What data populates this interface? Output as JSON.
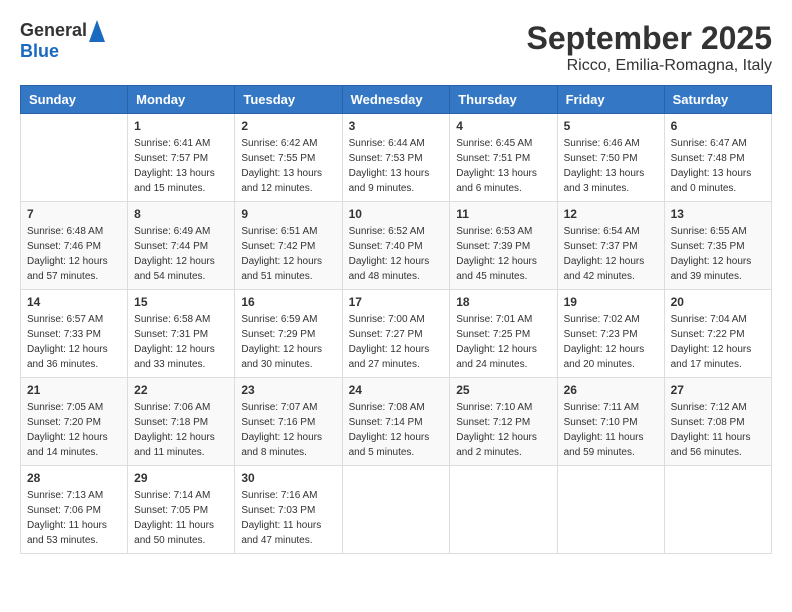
{
  "logo": {
    "general": "General",
    "blue": "Blue"
  },
  "title": {
    "month": "September 2025",
    "location": "Ricco, Emilia-Romagna, Italy"
  },
  "headers": [
    "Sunday",
    "Monday",
    "Tuesday",
    "Wednesday",
    "Thursday",
    "Friday",
    "Saturday"
  ],
  "weeks": [
    [
      {
        "day": "",
        "info": ""
      },
      {
        "day": "1",
        "info": "Sunrise: 6:41 AM\nSunset: 7:57 PM\nDaylight: 13 hours\nand 15 minutes."
      },
      {
        "day": "2",
        "info": "Sunrise: 6:42 AM\nSunset: 7:55 PM\nDaylight: 13 hours\nand 12 minutes."
      },
      {
        "day": "3",
        "info": "Sunrise: 6:44 AM\nSunset: 7:53 PM\nDaylight: 13 hours\nand 9 minutes."
      },
      {
        "day": "4",
        "info": "Sunrise: 6:45 AM\nSunset: 7:51 PM\nDaylight: 13 hours\nand 6 minutes."
      },
      {
        "day": "5",
        "info": "Sunrise: 6:46 AM\nSunset: 7:50 PM\nDaylight: 13 hours\nand 3 minutes."
      },
      {
        "day": "6",
        "info": "Sunrise: 6:47 AM\nSunset: 7:48 PM\nDaylight: 13 hours\nand 0 minutes."
      }
    ],
    [
      {
        "day": "7",
        "info": "Sunrise: 6:48 AM\nSunset: 7:46 PM\nDaylight: 12 hours\nand 57 minutes."
      },
      {
        "day": "8",
        "info": "Sunrise: 6:49 AM\nSunset: 7:44 PM\nDaylight: 12 hours\nand 54 minutes."
      },
      {
        "day": "9",
        "info": "Sunrise: 6:51 AM\nSunset: 7:42 PM\nDaylight: 12 hours\nand 51 minutes."
      },
      {
        "day": "10",
        "info": "Sunrise: 6:52 AM\nSunset: 7:40 PM\nDaylight: 12 hours\nand 48 minutes."
      },
      {
        "day": "11",
        "info": "Sunrise: 6:53 AM\nSunset: 7:39 PM\nDaylight: 12 hours\nand 45 minutes."
      },
      {
        "day": "12",
        "info": "Sunrise: 6:54 AM\nSunset: 7:37 PM\nDaylight: 12 hours\nand 42 minutes."
      },
      {
        "day": "13",
        "info": "Sunrise: 6:55 AM\nSunset: 7:35 PM\nDaylight: 12 hours\nand 39 minutes."
      }
    ],
    [
      {
        "day": "14",
        "info": "Sunrise: 6:57 AM\nSunset: 7:33 PM\nDaylight: 12 hours\nand 36 minutes."
      },
      {
        "day": "15",
        "info": "Sunrise: 6:58 AM\nSunset: 7:31 PM\nDaylight: 12 hours\nand 33 minutes."
      },
      {
        "day": "16",
        "info": "Sunrise: 6:59 AM\nSunset: 7:29 PM\nDaylight: 12 hours\nand 30 minutes."
      },
      {
        "day": "17",
        "info": "Sunrise: 7:00 AM\nSunset: 7:27 PM\nDaylight: 12 hours\nand 27 minutes."
      },
      {
        "day": "18",
        "info": "Sunrise: 7:01 AM\nSunset: 7:25 PM\nDaylight: 12 hours\nand 24 minutes."
      },
      {
        "day": "19",
        "info": "Sunrise: 7:02 AM\nSunset: 7:23 PM\nDaylight: 12 hours\nand 20 minutes."
      },
      {
        "day": "20",
        "info": "Sunrise: 7:04 AM\nSunset: 7:22 PM\nDaylight: 12 hours\nand 17 minutes."
      }
    ],
    [
      {
        "day": "21",
        "info": "Sunrise: 7:05 AM\nSunset: 7:20 PM\nDaylight: 12 hours\nand 14 minutes."
      },
      {
        "day": "22",
        "info": "Sunrise: 7:06 AM\nSunset: 7:18 PM\nDaylight: 12 hours\nand 11 minutes."
      },
      {
        "day": "23",
        "info": "Sunrise: 7:07 AM\nSunset: 7:16 PM\nDaylight: 12 hours\nand 8 minutes."
      },
      {
        "day": "24",
        "info": "Sunrise: 7:08 AM\nSunset: 7:14 PM\nDaylight: 12 hours\nand 5 minutes."
      },
      {
        "day": "25",
        "info": "Sunrise: 7:10 AM\nSunset: 7:12 PM\nDaylight: 12 hours\nand 2 minutes."
      },
      {
        "day": "26",
        "info": "Sunrise: 7:11 AM\nSunset: 7:10 PM\nDaylight: 11 hours\nand 59 minutes."
      },
      {
        "day": "27",
        "info": "Sunrise: 7:12 AM\nSunset: 7:08 PM\nDaylight: 11 hours\nand 56 minutes."
      }
    ],
    [
      {
        "day": "28",
        "info": "Sunrise: 7:13 AM\nSunset: 7:06 PM\nDaylight: 11 hours\nand 53 minutes."
      },
      {
        "day": "29",
        "info": "Sunrise: 7:14 AM\nSunset: 7:05 PM\nDaylight: 11 hours\nand 50 minutes."
      },
      {
        "day": "30",
        "info": "Sunrise: 7:16 AM\nSunset: 7:03 PM\nDaylight: 11 hours\nand 47 minutes."
      },
      {
        "day": "",
        "info": ""
      },
      {
        "day": "",
        "info": ""
      },
      {
        "day": "",
        "info": ""
      },
      {
        "day": "",
        "info": ""
      }
    ]
  ]
}
